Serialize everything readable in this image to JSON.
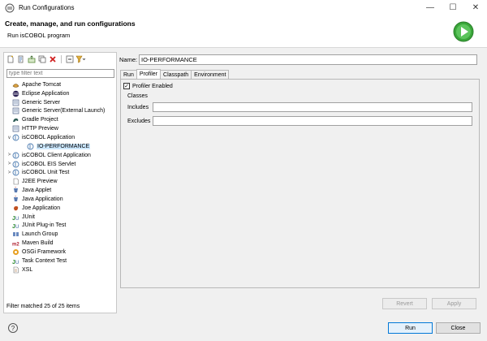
{
  "window": {
    "title": "Run Configurations",
    "minimize": "—",
    "maximize": "☐",
    "close": "✕"
  },
  "header": {
    "title": "Create, manage, and run configurations",
    "subtitle": "Run isCOBOL program"
  },
  "left": {
    "filter_placeholder": "type filter text",
    "status": "Filter matched 25 of 25 items",
    "tree": [
      {
        "label": "Apache Tomcat",
        "level": 0,
        "twisty": "",
        "icon": "tomcat-icon"
      },
      {
        "label": "Eclipse Application",
        "level": 0,
        "twisty": "",
        "icon": "eclipse-icon"
      },
      {
        "label": "Generic Server",
        "level": 0,
        "twisty": "",
        "icon": "server-icon"
      },
      {
        "label": "Generic Server(External Launch)",
        "level": 0,
        "twisty": "",
        "icon": "server-icon"
      },
      {
        "label": "Gradle Project",
        "level": 0,
        "twisty": "",
        "icon": "gradle-icon"
      },
      {
        "label": "HTTP Preview",
        "level": 0,
        "twisty": "",
        "icon": "server-icon"
      },
      {
        "label": "isCOBOL Application",
        "level": 0,
        "twisty": "∨",
        "icon": "iscobol-icon"
      },
      {
        "label": "IO-PERFORMANCE",
        "level": 1,
        "twisty": "",
        "icon": "iscobol-icon",
        "selected": true
      },
      {
        "label": "isCOBOL Client Application",
        "level": 0,
        "twisty": ">",
        "icon": "iscobol-icon"
      },
      {
        "label": "isCOBOL EIS Servlet",
        "level": 0,
        "twisty": ">",
        "icon": "iscobol-icon"
      },
      {
        "label": "isCOBOL Unit Test",
        "level": 0,
        "twisty": ">",
        "icon": "iscobol-icon"
      },
      {
        "label": "J2EE Preview",
        "level": 0,
        "twisty": "",
        "icon": "page-icon"
      },
      {
        "label": "Java Applet",
        "level": 0,
        "twisty": "",
        "icon": "java-icon"
      },
      {
        "label": "Java Application",
        "level": 0,
        "twisty": "",
        "icon": "java-icon"
      },
      {
        "label": "Joe Application",
        "level": 0,
        "twisty": "",
        "icon": "joe-icon"
      },
      {
        "label": "JUnit",
        "level": 0,
        "twisty": "",
        "icon": "junit-icon"
      },
      {
        "label": "JUnit Plug-in Test",
        "level": 0,
        "twisty": "",
        "icon": "junit-icon"
      },
      {
        "label": "Launch Group",
        "level": 0,
        "twisty": "",
        "icon": "launch-group-icon"
      },
      {
        "label": "Maven Build",
        "level": 0,
        "twisty": "",
        "icon": "maven-icon"
      },
      {
        "label": "OSGi Framework",
        "level": 0,
        "twisty": "",
        "icon": "osgi-icon"
      },
      {
        "label": "Task Context Test",
        "level": 0,
        "twisty": "",
        "icon": "junit-icon"
      },
      {
        "label": "XSL",
        "level": 0,
        "twisty": "",
        "icon": "xsl-icon"
      }
    ]
  },
  "right": {
    "name_label": "Name:",
    "name_value": "IO-PERFORMANCE",
    "tabs": [
      "Run",
      "Profiler",
      "Classpath",
      "Environment"
    ],
    "active_tab": "Profiler",
    "profiler": {
      "enabled_label": "Profiler Enabled",
      "enabled": true,
      "classes_label": "Classes",
      "includes_label": "Includes",
      "excludes_label": "Excludes",
      "includes_value": "",
      "excludes_value": ""
    },
    "revert_label": "Revert",
    "apply_label": "Apply"
  },
  "footer": {
    "help": "?",
    "run_label": "Run",
    "close_label": "Close"
  },
  "colors": {
    "accent": "#0078d7",
    "selection": "#cce8ff",
    "run_green": "#3aa63a"
  }
}
